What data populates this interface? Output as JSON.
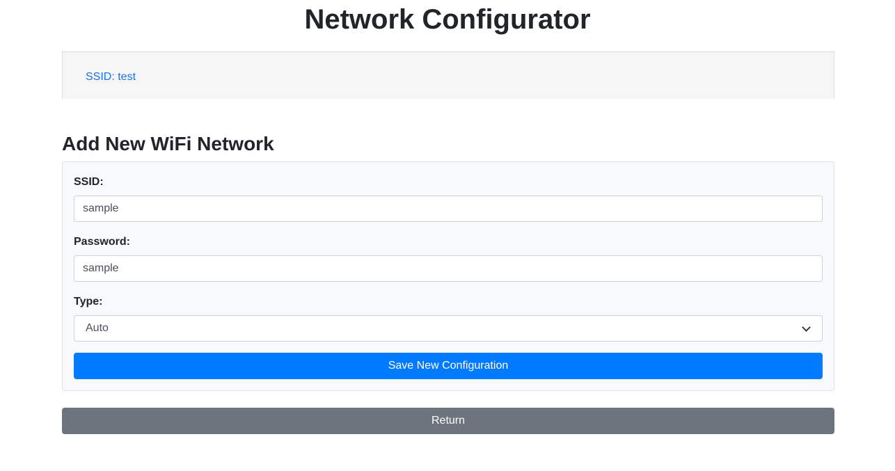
{
  "header": {
    "title": "Network Configurator"
  },
  "saved_networks": {
    "items": [
      {
        "label": "SSID: test"
      }
    ]
  },
  "add_network": {
    "title": "Add New WiFi Network",
    "ssid": {
      "label": "SSID:",
      "value": "sample"
    },
    "password": {
      "label": "Password:",
      "value": "sample"
    },
    "type": {
      "label": "Type:",
      "selected": "Auto"
    },
    "save_label": "Save New Configuration"
  },
  "return_label": "Return",
  "colors": {
    "primary": "#007bff",
    "secondary": "#6c757d",
    "link": "#1a73e8"
  }
}
